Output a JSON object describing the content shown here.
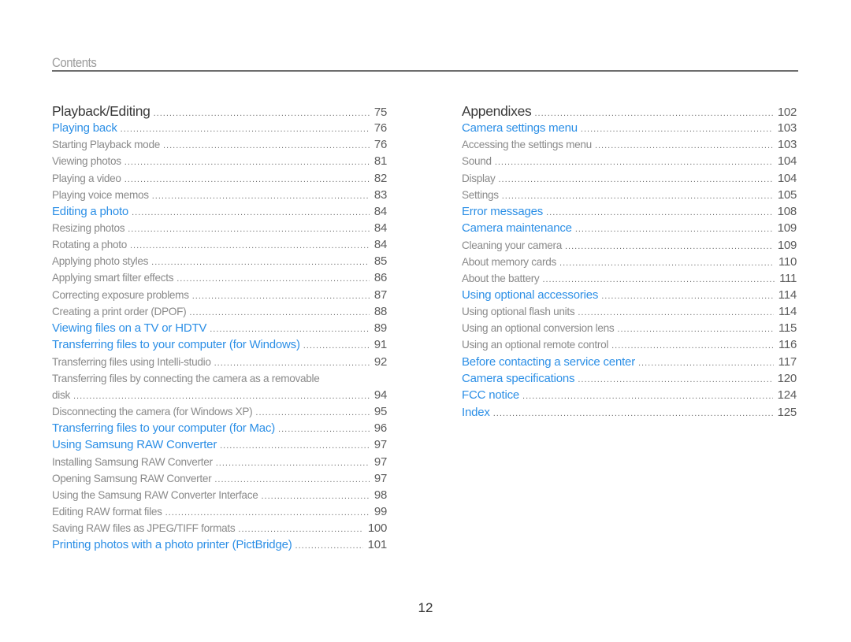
{
  "header": {
    "title": "Contents"
  },
  "left_column": [
    {
      "level": 0,
      "label": "Playback/Editing",
      "page": "75"
    },
    {
      "level": 1,
      "label": "Playing back",
      "page": "76"
    },
    {
      "level": 2,
      "label": "Starting Playback mode",
      "page": "76"
    },
    {
      "level": 2,
      "label": "Viewing photos",
      "page": "81"
    },
    {
      "level": 2,
      "label": "Playing a video",
      "page": "82"
    },
    {
      "level": 2,
      "label": "Playing voice memos",
      "page": "83"
    },
    {
      "level": 1,
      "label": "Editing a photo",
      "page": "84"
    },
    {
      "level": 2,
      "label": "Resizing photos",
      "page": "84"
    },
    {
      "level": 2,
      "label": "Rotating a photo",
      "page": "84"
    },
    {
      "level": 2,
      "label": "Applying photo styles",
      "page": "85"
    },
    {
      "level": 2,
      "label": "Applying smart filter effects",
      "page": "86"
    },
    {
      "level": 2,
      "label": "Correcting exposure problems",
      "page": "87"
    },
    {
      "level": 2,
      "label": "Creating a print order (DPOF)",
      "page": "88"
    },
    {
      "level": 1,
      "label": "Viewing files on a TV or HDTV",
      "page": "89"
    },
    {
      "level": 1,
      "label": "Transferring files to your computer (for Windows)",
      "page": "91"
    },
    {
      "level": 2,
      "label": "Transferring files using Intelli-studio",
      "page": "92"
    },
    {
      "level": 2,
      "label_line1": "Transferring files by connecting the camera as a removable",
      "label": "disk",
      "page": "94"
    },
    {
      "level": 2,
      "label": "Disconnecting the camera (for Windows XP)",
      "page": "95"
    },
    {
      "level": 1,
      "label": "Transferring files to your computer (for Mac)",
      "page": "96"
    },
    {
      "level": 1,
      "label": "Using Samsung RAW Converter",
      "page": "97"
    },
    {
      "level": 2,
      "label": "Installing Samsung RAW Converter",
      "page": "97"
    },
    {
      "level": 2,
      "label": "Opening Samsung RAW Converter",
      "page": "97"
    },
    {
      "level": 2,
      "label": "Using the Samsung RAW Converter Interface",
      "page": "98"
    },
    {
      "level": 2,
      "label": "Editing RAW format files",
      "page": "99"
    },
    {
      "level": 2,
      "label": "Saving RAW files as JPEG/TIFF formats",
      "page": "100"
    },
    {
      "level": 1,
      "label": "Printing photos with a photo printer (PictBridge)",
      "page": "101"
    }
  ],
  "right_column": [
    {
      "level": 0,
      "label": "Appendixes",
      "page": "102"
    },
    {
      "level": 1,
      "label": "Camera settings menu",
      "page": "103"
    },
    {
      "level": 2,
      "label": "Accessing the settings menu",
      "page": "103"
    },
    {
      "level": 2,
      "label": "Sound",
      "page": "104"
    },
    {
      "level": 2,
      "label": "Display",
      "page": "104"
    },
    {
      "level": 2,
      "label": "Settings",
      "page": "105"
    },
    {
      "level": 1,
      "label": "Error messages",
      "page": "108"
    },
    {
      "level": 1,
      "label": "Camera maintenance",
      "page": "109"
    },
    {
      "level": 2,
      "label": "Cleaning your camera",
      "page": "109"
    },
    {
      "level": 2,
      "label": "About memory cards",
      "page": "110"
    },
    {
      "level": 2,
      "label": "About the battery",
      "page": "111"
    },
    {
      "level": 1,
      "label": "Using optional accessories",
      "page": "114"
    },
    {
      "level": 2,
      "label": "Using optional flash units",
      "page": "114"
    },
    {
      "level": 2,
      "label": "Using an optional conversion lens",
      "page": "115"
    },
    {
      "level": 2,
      "label": "Using an optional remote control",
      "page": "116"
    },
    {
      "level": 1,
      "label": "Before contacting a service center",
      "page": "117"
    },
    {
      "level": 1,
      "label": "Camera specifications",
      "page": "120"
    },
    {
      "level": 1,
      "label": "FCC notice",
      "page": "124"
    },
    {
      "level": 1,
      "label": "Index",
      "page": "125"
    }
  ],
  "footer": {
    "page_number": "12"
  },
  "colors": {
    "link": "#2c8fe6",
    "heading": "#3a3a3a",
    "subitem": "#8a8a8a",
    "rule": "#6e6e6e"
  }
}
